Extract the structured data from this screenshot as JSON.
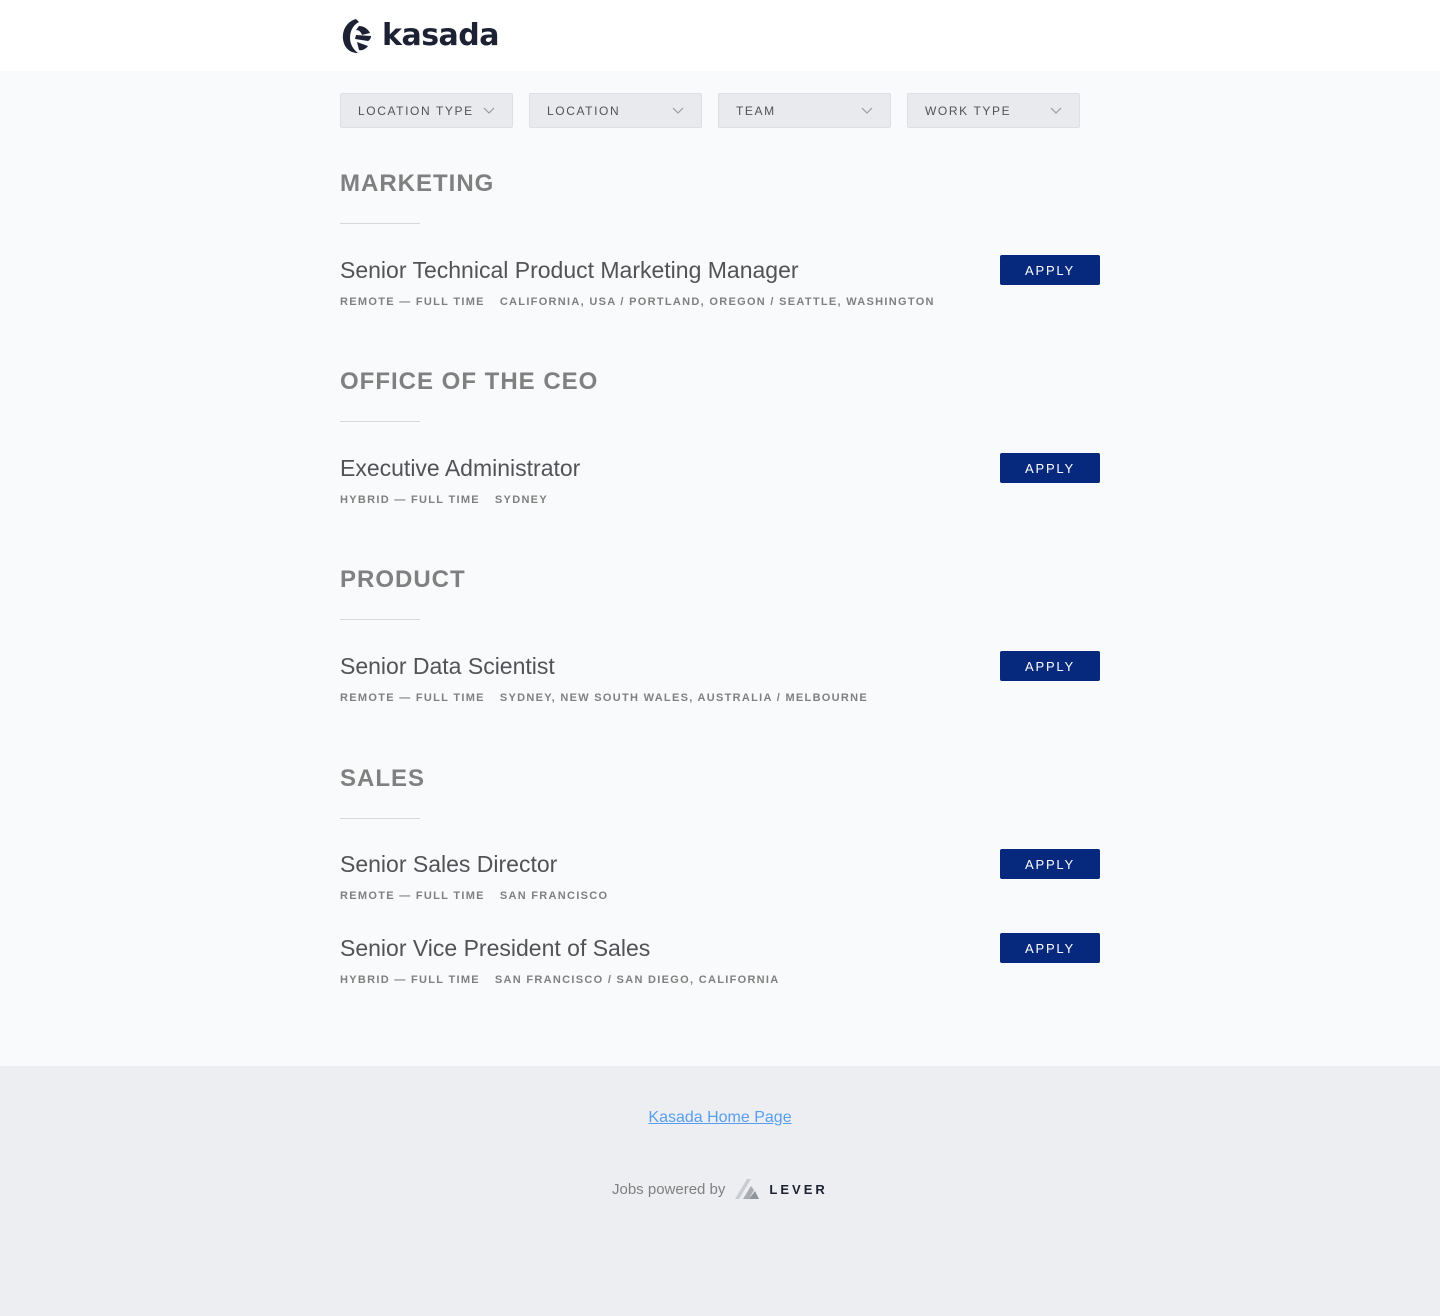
{
  "brand": {
    "name": "kasada",
    "logo_icon": "kasada-logo-icon"
  },
  "filters": [
    {
      "label": "LOCATION TYPE"
    },
    {
      "label": "LOCATION"
    },
    {
      "label": "TEAM"
    },
    {
      "label": "WORK TYPE"
    }
  ],
  "sections": [
    {
      "title": "MARKETING",
      "postings": [
        {
          "title": "Senior Technical Product Marketing Manager",
          "commitment": "REMOTE — FULL TIME",
          "location": "CALIFORNIA, USA / PORTLAND, OREGON / SEATTLE, WASHINGTON",
          "apply_label": "APPLY"
        }
      ]
    },
    {
      "title": "OFFICE OF THE CEO",
      "postings": [
        {
          "title": "Executive Administrator",
          "commitment": "HYBRID — FULL TIME",
          "location": "SYDNEY",
          "apply_label": "APPLY"
        }
      ]
    },
    {
      "title": "PRODUCT",
      "postings": [
        {
          "title": "Senior Data Scientist",
          "commitment": "REMOTE — FULL TIME",
          "location": "SYDNEY, NEW SOUTH WALES, AUSTRALIA / MELBOURNE",
          "apply_label": "APPLY"
        }
      ]
    },
    {
      "title": "SALES",
      "postings": [
        {
          "title": "Senior Sales Director",
          "commitment": "REMOTE — FULL TIME",
          "location": "SAN FRANCISCO",
          "apply_label": "APPLY"
        },
        {
          "title": "Senior Vice President of Sales",
          "commitment": "HYBRID — FULL TIME",
          "location": "SAN FRANCISCO / SAN DIEGO, CALIFORNIA",
          "apply_label": "APPLY"
        }
      ]
    }
  ],
  "footer": {
    "home_link": "Kasada Home Page",
    "powered_by": "Jobs powered by",
    "lever_label": "LEVER"
  },
  "colors": {
    "accent": "#06297d",
    "link": "#579eee",
    "background": "#f9fafb",
    "footer_background": "#edeef1"
  }
}
